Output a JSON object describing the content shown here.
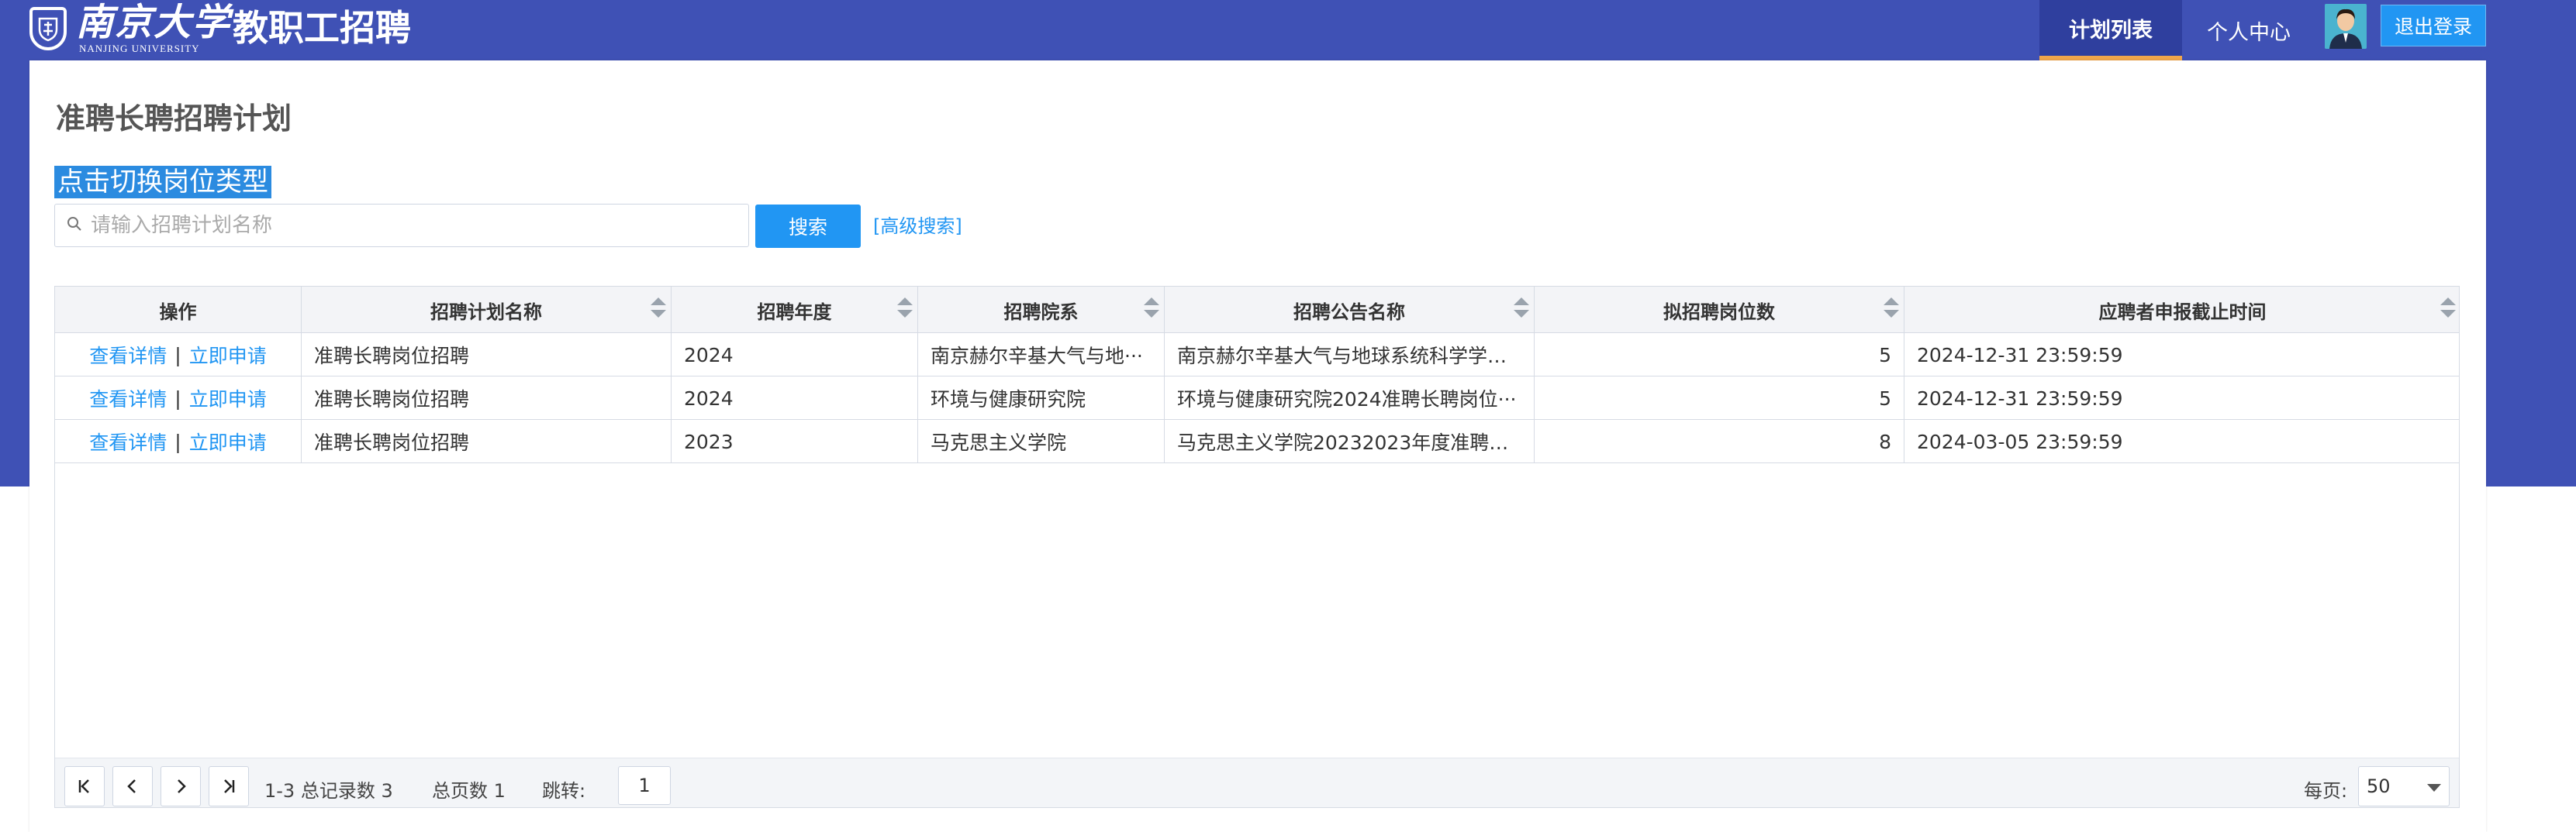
{
  "header": {
    "logo_cn": "南京大学",
    "logo_en": "NANJING UNIVERSITY",
    "app_title": "教职工招聘",
    "nav_plans": "计划列表",
    "nav_profile": "个人中心",
    "logout": "退出登录",
    "brand_color": "#3f51b5",
    "accent_color": "#2196f3"
  },
  "main": {
    "page_title": "准聘长聘招聘计划",
    "switch_type": "点击切换岗位类型",
    "search_placeholder": "请输入招聘计划名称",
    "search_button": "搜索",
    "advanced_search": "[高级搜索]"
  },
  "table": {
    "columns": [
      "操作",
      "招聘计划名称",
      "招聘年度",
      "招聘院系",
      "招聘公告名称",
      "拟招聘岗位数",
      "应聘者申报截止时间"
    ],
    "action_view": "查看详情",
    "action_sep": "|",
    "action_apply": "立即申请",
    "rows": [
      {
        "name": "准聘长聘岗位招聘",
        "year": "2024",
        "dept": "南京赫尔辛基大气与地···",
        "notice": "南京赫尔辛基大气与地球系统科学学院···",
        "count": "5",
        "deadline": "2024-12-31 23:59:59"
      },
      {
        "name": "准聘长聘岗位招聘",
        "year": "2024",
        "dept": "环境与健康研究院",
        "notice": "环境与健康研究院2024准聘长聘岗位···",
        "count": "5",
        "deadline": "2024-12-31 23:59:59"
      },
      {
        "name": "准聘长聘岗位招聘",
        "year": "2023",
        "dept": "马克思主义学院",
        "notice": "马克思主义学院20232023年度准聘长···",
        "count": "8",
        "deadline": "2024-03-05 23:59:59"
      }
    ]
  },
  "pager": {
    "first_icon": "first-page-icon",
    "prev_icon": "prev-page-icon",
    "next_icon": "next-page-icon",
    "last_icon": "last-page-icon",
    "range": "1-3 总记录数 3",
    "total_pages": "总页数 1",
    "jump_label": "跳转:",
    "jump_value": "1",
    "page_size_label": "每页:",
    "page_size_value": "50"
  }
}
